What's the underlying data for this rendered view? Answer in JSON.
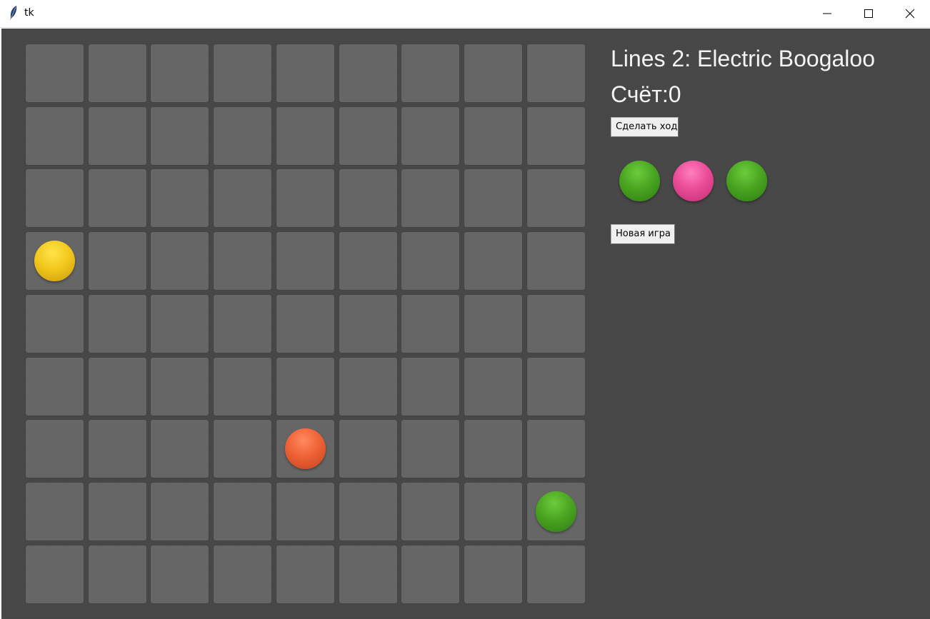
{
  "window": {
    "title": "tk",
    "controls": [
      "minimize-icon",
      "maximize-icon",
      "close-icon"
    ]
  },
  "game": {
    "title": "Lines 2: Electric Boogaloo",
    "score_label": "Счёт:0",
    "move_button_label": "Сделать ход",
    "new_game_button_label": "Новая игра"
  },
  "board": {
    "rows": 9,
    "cols": 9,
    "balls": [
      {
        "row": 3,
        "col": 0,
        "color": "yellow"
      },
      {
        "row": 6,
        "col": 4,
        "color": "orange"
      },
      {
        "row": 7,
        "col": 8,
        "color": "green"
      }
    ]
  },
  "next_balls": [
    "green",
    "pink",
    "green"
  ],
  "colors": {
    "background": "#464646",
    "cell": "#666666",
    "yellow": "#f2c81d",
    "orange": "#ef6236",
    "green": "#4aa521",
    "pink": "#ea4c98"
  }
}
